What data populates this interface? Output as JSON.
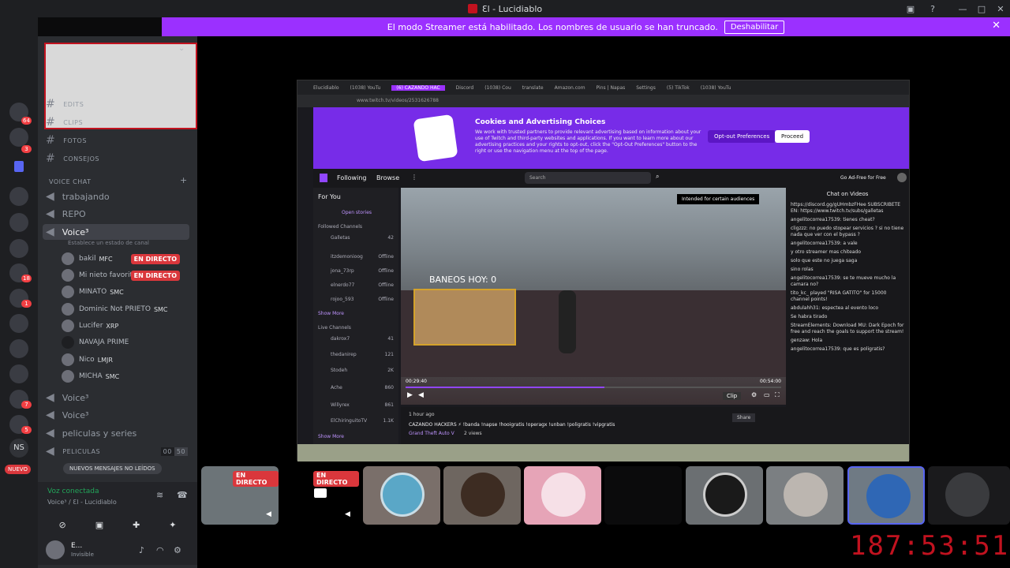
{
  "window": {
    "title": "Ɛl - Lucidiablo"
  },
  "banner": {
    "text": "El modo Streamer está habilitado. Los nombres de usuario se han truncado.",
    "button": "Deshabilitar"
  },
  "server_badges": [
    "64",
    "3",
    "18",
    "1",
    "7",
    "5"
  ],
  "channels": {
    "text": [
      {
        "label": "EDITS"
      },
      {
        "label": "CLIPS"
      },
      {
        "label": "FOTOS"
      },
      {
        "label": "CONSEJOS"
      }
    ],
    "voice_category": "VOICE CHAT",
    "voice": [
      "trabajando",
      "REPO"
    ],
    "active_voice": "Voice³",
    "active_voice_status": "Establece un estado de canal",
    "users": [
      {
        "name": "bakil",
        "tag": "MFC",
        "live": true
      },
      {
        "name": "Mi nieto favorito",
        "tag": "",
        "live": true
      },
      {
        "name": "MINATO",
        "tag": "SMC",
        "live": false
      },
      {
        "name": "Dominic Not PRIETO",
        "tag": "SMC",
        "live": false
      },
      {
        "name": "Lucifer",
        "tag": "XRP",
        "live": false
      },
      {
        "name": "NAVAJA PRIME",
        "tag": "",
        "live": false
      },
      {
        "name": "Nico",
        "tag": "LMJR",
        "live": false
      },
      {
        "name": "MICHA",
        "tag": "SMC",
        "live": false
      }
    ],
    "live_label": "EN DIRECTO",
    "more_voice": [
      "Voice³",
      "Voice³",
      "peliculas y series"
    ],
    "peliculas": "PELICULAS",
    "peliculas_count": [
      "00",
      "50"
    ],
    "unread_pill": "NUEVOS MENSAJES NO LEÍDOS",
    "new_badge": "NUEVO",
    "ns": "NS"
  },
  "voice_panel": {
    "status": "Voz conectada",
    "channel": "Voice³ / Ɛl - Lucidiablo",
    "user": "E...",
    "user_status": "Invisible"
  },
  "stream": {
    "tabs": [
      "Elucidiablo",
      "(1038) YouTu",
      "(6) CAZANDO HAC",
      "Discord",
      "(1038) Cou",
      "translate",
      "Amazon.com",
      "Pins | Napas",
      "Settings",
      "(5) TikTok",
      "(1038) YouTu"
    ],
    "url": "www.twitch.tv/videos/2531626788",
    "cookie_title": "Cookies and Advertising Choices",
    "cookie_body": "We work with trusted partners to provide relevant advertising based on information about your use of Twitch and third-party websites and applications. If you want to learn more about our advertising practices and your rights to opt-out, click the \"Opt-Out Preferences\" button to the right or use the navigation menu at the top of the page.",
    "opt_out": "Opt-out Preferences",
    "proceed": "Proceed",
    "nav": {
      "following": "Following",
      "browse": "Browse",
      "search": "Search",
      "ad_free": "Go Ad-Free for Free"
    },
    "sidebar": {
      "for_you": "For You",
      "open_stories": "Open stories",
      "followed": "Followed Channels",
      "followed_list": [
        [
          "Galletas",
          "42"
        ],
        [
          "itzdemonioog",
          "Offline"
        ],
        [
          "jona_73rp",
          "Offline"
        ],
        [
          "elnerdo77",
          "Offline"
        ],
        [
          "rojoo_593",
          "Offline"
        ]
      ],
      "show_more": "Show More",
      "live_channels": "Live Channels",
      "live_list": [
        [
          "dakrox7",
          "41"
        ],
        [
          "thedanirep",
          "121"
        ],
        [
          "Stodeh",
          "2K"
        ],
        [
          "Ache",
          "860"
        ],
        [
          "Willyrex",
          "861"
        ],
        [
          "ElChiringuitoTV",
          "1.1K"
        ]
      ]
    },
    "video": {
      "overlay_text": "BANEOS HOY: 0",
      "audience": "Intended for certain audiences",
      "time_cur": "00:29:40",
      "time_total": "00:54:00",
      "clip": "Clip"
    },
    "below": {
      "ago": "1 hour ago",
      "title": "CAZANDO HACKERS ⚡ !banda !napse !hooigratis !operagx !unban !poligratis !vipgratis",
      "game": "Grand Theft Auto V",
      "views": "2 views",
      "share": "Share"
    },
    "chat": {
      "header": "Chat on Videos",
      "lines": [
        "https://discord.gg/gUHmbzFHee SUBSCRIBETE EN: https://www.twitch.tv/subs/galletas",
        "angelitocorrea17539: tienes cheat?",
        "cligzzz: no puedo stopear servicios ? si no tiene nada que ver con el bypass ?",
        "angelitocorrea17539: a vale",
        "y otro streamer mas chiteado",
        "solo que este no juega saga",
        "sino rolas",
        "angelitocorrea17539: se te mueve mucho la camara no?",
        "tito_kc_ played \"RISA GATITO\" for 15000 channel points!",
        "abdulahh31: espectea al evento loco",
        "Se habra tirado",
        "StreamElements: Download MU: Dark Epoch for free and reach the goals to support the stream!",
        "genzaw: Hola",
        "angelitocorrea17539: que es poligratis?"
      ]
    }
  },
  "tiles": [
    {
      "live": "EN DIRECTO"
    },
    {
      "live": "EN DIRECTO"
    }
  ],
  "timer": "187:53:51",
  "colors": {
    "brand": "#9b30ff",
    "live": "#da373c",
    "timer": "#c1121f"
  }
}
